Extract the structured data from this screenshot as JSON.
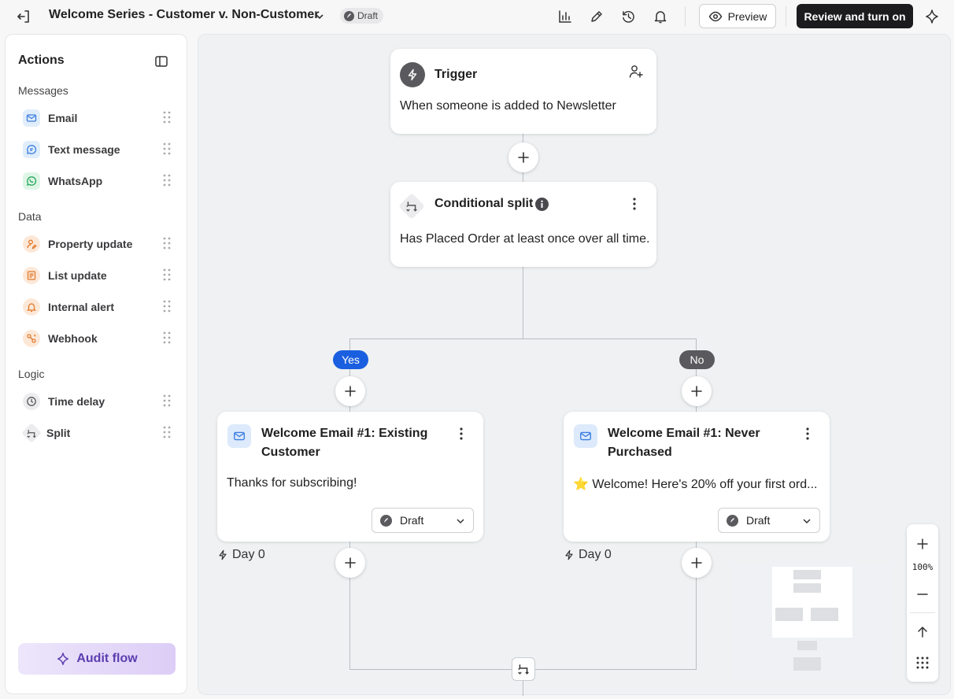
{
  "header": {
    "back_icon": "exit-arrow-icon",
    "title": "Welcome Series - Customer v. Non-Customer",
    "status_badge": "Draft",
    "preview_label": "Preview",
    "review_label": "Review and turn on"
  },
  "sidebar": {
    "title": "Actions",
    "sections": {
      "messages": "Messages",
      "data": "Data",
      "logic": "Logic"
    },
    "items": [
      {
        "label": "Email",
        "icon": "mail-icon"
      },
      {
        "label": "Text message",
        "icon": "chat-bubble-icon"
      },
      {
        "label": "WhatsApp",
        "icon": "whatsapp-icon"
      },
      {
        "label": "Property update",
        "icon": "person-edit-icon"
      },
      {
        "label": "List update",
        "icon": "list-icon"
      },
      {
        "label": "Internal alert",
        "icon": "bell-icon"
      },
      {
        "label": "Webhook",
        "icon": "webhook-icon"
      },
      {
        "label": "Time delay",
        "icon": "clock-icon"
      },
      {
        "label": "Split",
        "icon": "split-icon"
      }
    ],
    "audit_label": "Audit flow"
  },
  "flow": {
    "trigger": {
      "title": "Trigger",
      "text": "When someone is added to Newsletter"
    },
    "split": {
      "title": "Conditional split",
      "text": "Has Placed Order at least once over all time."
    },
    "branch_yes": "Yes",
    "branch_no": "No",
    "email_yes": {
      "title": "Welcome Email #1: Existing Customer",
      "text": "Thanks for subscribing!",
      "status": "Draft",
      "delay": "Day 0"
    },
    "email_no": {
      "title": "Welcome Email #1: Never Purchased",
      "text": "⭐ Welcome! Here's 20% off your first ord...",
      "status": "Draft",
      "delay": "Day 0"
    }
  },
  "zoom": {
    "level": "100%"
  },
  "colors": {
    "yes_pill": "#1a5fe0",
    "no_pill": "#5a5a5e",
    "review_button": "#1c1c1e",
    "audit_text": "#5b3db0"
  }
}
